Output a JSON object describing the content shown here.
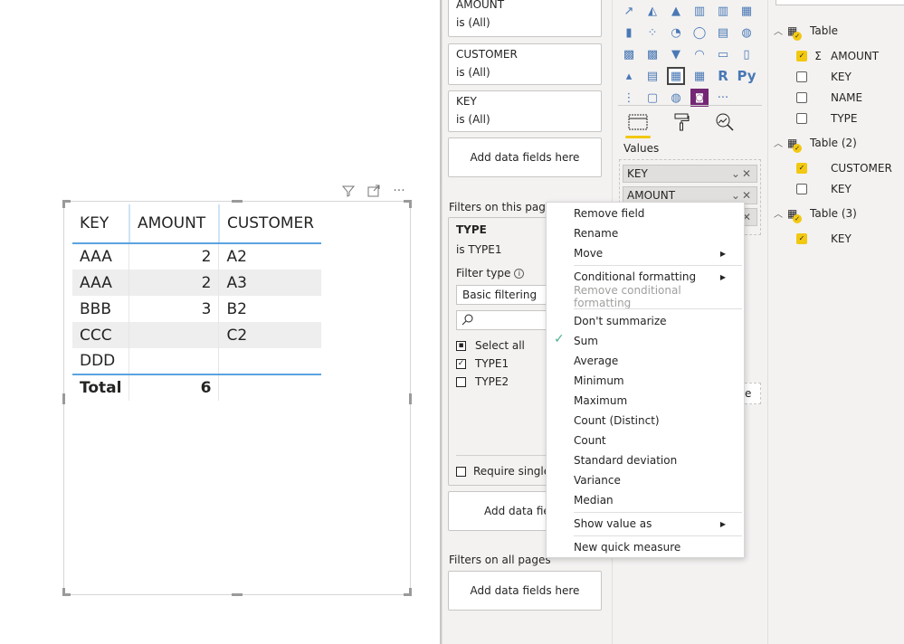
{
  "canvas": {
    "visual_header": {
      "filter_icon": "filter-icon",
      "focus_icon": "focus-mode-icon",
      "more_icon": "more-options-icon"
    },
    "table": {
      "columns": [
        "KEY",
        "AMOUNT",
        "CUSTOMER"
      ],
      "rows": [
        {
          "key": "AAA",
          "amount": "2",
          "customer": "A2"
        },
        {
          "key": "AAA",
          "amount": "2",
          "customer": "A3"
        },
        {
          "key": "BBB",
          "amount": "3",
          "customer": "B2"
        },
        {
          "key": "CCC",
          "amount": "",
          "customer": "C2"
        },
        {
          "key": "DDD",
          "amount": "",
          "customer": ""
        }
      ],
      "total": {
        "label": "Total",
        "amount": "6",
        "customer": ""
      }
    }
  },
  "filters": {
    "visual_filters": [
      {
        "field": "AMOUNT",
        "state": "is (All)"
      },
      {
        "field": "CUSTOMER",
        "state": "is (All)"
      },
      {
        "field": "KEY",
        "state": "is (All)"
      }
    ],
    "add_fields_label": "Add data fields here",
    "page_section_label": "Filters on this page",
    "page_filter": {
      "field": "TYPE",
      "state": "is TYPE1",
      "filter_type_label": "Filter type",
      "filter_type_value": "Basic filtering",
      "options": [
        {
          "label": "Select all",
          "state": "partial"
        },
        {
          "label": "TYPE1",
          "state": "checked"
        },
        {
          "label": "TYPE2",
          "state": "unchecked"
        }
      ],
      "require_single": "Require single s"
    },
    "page_add_fields_label": "Add data fields",
    "all_pages_section_label": "Filters on all pages",
    "all_pages_add_fields_label": "Add data fields here"
  },
  "visualizations": {
    "icons": [
      "line-chart-icon",
      "area-chart-icon",
      "stacked-area-chart-icon",
      "line-clustered-column-icon",
      "line-stacked-column-icon",
      "ribbon-chart-icon",
      "waterfall-chart-icon",
      "scatter-chart-icon",
      "pie-chart-icon",
      "donut-chart-icon",
      "treemap-icon",
      "map-icon",
      "filled-map-icon",
      "shape-map-icon",
      "funnel-icon",
      "gauge-icon",
      "card-icon",
      "multi-row-card-icon",
      "kpi-icon",
      "slicer-icon",
      "table-icon",
      "matrix-icon",
      "r-visual-icon",
      "python-visual-icon",
      "key-influencers-icon",
      "qa-icon",
      "arcgis-map-icon",
      "power-apps-icon",
      "more-visuals-icon"
    ],
    "icon_glyphs": [
      "↗",
      "◭",
      "▲",
      "▥",
      "▥",
      "▦",
      "▮",
      "⁘",
      "◔",
      "◯",
      "▤",
      "◍",
      "▩",
      "▩",
      "▼",
      "◠",
      "▭",
      "▯",
      "▴",
      "▤",
      "▦",
      "▦",
      "R",
      "Py",
      "⋮",
      "▢",
      "◍",
      "◙",
      "···"
    ],
    "selected_icon_index": 20,
    "tabs": [
      "fields-tab",
      "format-tab",
      "analytics-tab"
    ],
    "values_label": "Values",
    "value_pills": [
      "KEY",
      "AMOUNT",
      ""
    ],
    "drag_box_text": "e"
  },
  "fields": {
    "tables": [
      {
        "name": "Table",
        "fields": [
          {
            "name": "AMOUNT",
            "checked": true,
            "sigma": true
          },
          {
            "name": "KEY",
            "checked": false,
            "sigma": false
          },
          {
            "name": "NAME",
            "checked": false,
            "sigma": false
          },
          {
            "name": "TYPE",
            "checked": false,
            "sigma": false
          }
        ]
      },
      {
        "name": "Table (2)",
        "fields": [
          {
            "name": "CUSTOMER",
            "checked": true,
            "sigma": false
          },
          {
            "name": "KEY",
            "checked": false,
            "sigma": false
          }
        ]
      },
      {
        "name": "Table (3)",
        "fields": [
          {
            "name": "KEY",
            "checked": true,
            "sigma": false
          }
        ]
      }
    ]
  },
  "context_menu": {
    "items": [
      {
        "label": "Remove field"
      },
      {
        "label": "Rename"
      },
      {
        "label": "Move",
        "submenu": true
      },
      {
        "label": "Conditional formatting",
        "submenu": true
      },
      {
        "label": "Remove conditional formatting",
        "disabled": true
      },
      {
        "label": "Don't summarize"
      },
      {
        "label": "Sum",
        "checked": true
      },
      {
        "label": "Average"
      },
      {
        "label": "Minimum"
      },
      {
        "label": "Maximum"
      },
      {
        "label": "Count (Distinct)"
      },
      {
        "label": "Count"
      },
      {
        "label": "Standard deviation"
      },
      {
        "label": "Variance"
      },
      {
        "label": "Median"
      },
      {
        "label": "Show value as",
        "submenu": true
      },
      {
        "label": "New quick measure"
      }
    ]
  },
  "colors": {
    "accent_yellow": "#f2c811",
    "table_blue": "#5ba3e0",
    "check_green": "#4caf8f"
  }
}
